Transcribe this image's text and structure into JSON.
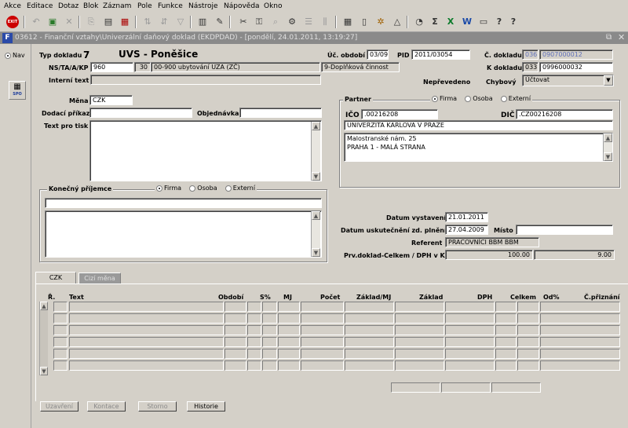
{
  "menu": [
    "Akce",
    "Editace",
    "Dotaz",
    "Blok",
    "Záznam",
    "Pole",
    "Funkce",
    "Nástroje",
    "Nápověda",
    "Okno"
  ],
  "toolbar_icons": [
    "exit-icon",
    "back-icon",
    "save-icon",
    "cancel-icon",
    "copy-icon",
    "print-icon",
    "delete-icon",
    "sort-icon",
    "sort-desc-icon",
    "filter-icon",
    "export-icon",
    "attach-icon",
    "cut-icon",
    "tree-icon",
    "lookup-icon",
    "tools-icon",
    "list-icon",
    "split-icon",
    "calculator-icon",
    "document-icon",
    "settings-icon",
    "triangle-icon",
    "clock-icon",
    "sigma-icon",
    "excel-icon",
    "word-icon",
    "keyboard-icon",
    "help-icon",
    "whatsthis-icon"
  ],
  "window": {
    "title": "03612 - Finanční vztahy\\Univerzální daňový doklad (EKDPDAD) - [pondělí, 24.01.2011, 13:19:27]"
  },
  "left": {
    "nav_label": "Nav",
    "spo_label": "SPO"
  },
  "header": {
    "typ_dokladu_label": "Typ dokladu",
    "typ_dokladu_value": "7",
    "doc_title": "UVS - Poněšice",
    "uc_obdobi_label": "Úč. období",
    "uc_obdobi_value": "03/09",
    "pid_label": "PID",
    "pid_value": "2011/03054",
    "c_dokladu_label": "Č. dokladu",
    "c_dokladu_prefix": "036",
    "c_dokladu_value": "0907000012",
    "k_dokladu_label": "K dokladu",
    "k_dokladu_prefix": "033",
    "k_dokladu_value": "0996000032",
    "nstaakp_label": "NS/TA/A/KP",
    "ns_value": "960",
    "ta_value": "30",
    "a_value": "00-900 ubytování UZA (ZČ)",
    "kp_value": "9-Doplňková činnost",
    "interni_text_label": "Interní text",
    "interni_text_value": "",
    "neprevedeno_label": "Nepřevedeno",
    "chybovy_label": "Chybový",
    "chybovy_value": "Účtovat"
  },
  "left_form": {
    "mena_label": "Měna",
    "mena_value": "CZK",
    "dodaci_prikaz_label": "Dodací příkaz",
    "objednavka_label": "Objednávka",
    "text_pro_tisk_label": "Text pro tisk"
  },
  "partner": {
    "group_label": "Partner",
    "radio_firma": "Firma",
    "radio_osoba": "Osoba",
    "radio_externi": "Externí",
    "ico_label": "IČO",
    "ico_value": ".00216208",
    "dic_label": "DIČ",
    "dic_value": ".CZ00216208",
    "name": "UNIVERZITA KARLOVA V PRAZE",
    "address_line1": "Malostranské nám. 25",
    "address_line2": "PRAHA 1 - MALÁ STRANA"
  },
  "konecny": {
    "group_label": "Konečný příjemce",
    "radio_firma": "Firma",
    "radio_osoba": "Osoba",
    "radio_externi": "Externí"
  },
  "dates": {
    "datum_vystaveni_label": "Datum vystavení",
    "datum_vystaveni_value": "21.01.2011",
    "datum_uskut_label": "Datum uskutečnění zd. plnění",
    "datum_uskut_value": "27.04.2009",
    "misto_label": "Místo",
    "referent_label": "Referent",
    "referent_value": "PRACOVNÍCI BBM BBM",
    "prv_label": "Prv.doklad-Celkem / DPH v Kč",
    "prv_celkem": "100.00",
    "prv_dph": "9.00"
  },
  "tabs": [
    "CZK",
    "Cizí měna"
  ],
  "table": {
    "headers": [
      "Ř.",
      "Text",
      "Období",
      "S%",
      "MJ",
      "Počet",
      "Základ/MJ",
      "Základ",
      "DPH",
      "Celkem",
      "Od%",
      "Č.přiznání"
    ],
    "row_count": 6
  },
  "buttons": {
    "uzavreni": "Uzavření",
    "kontace": "Kontace",
    "storno": "Storno",
    "historie": "Historie"
  }
}
